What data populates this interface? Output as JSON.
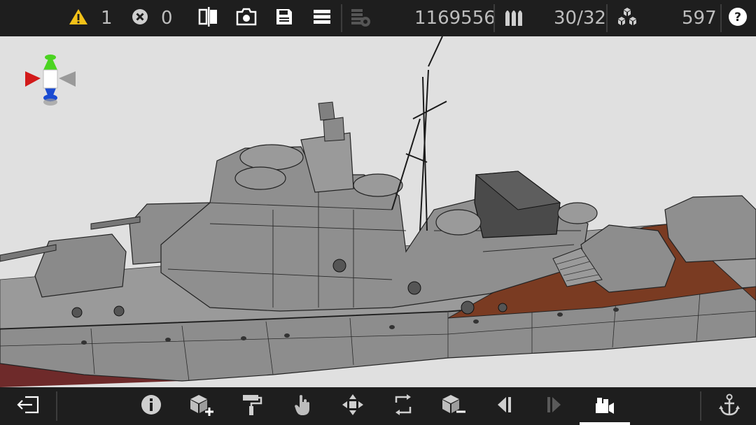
{
  "topbar": {
    "warnings_count": "1",
    "errors_count": "0",
    "polygon_count": "1169556",
    "ammo_count": "30/32",
    "parts_count": "597",
    "icons": {
      "warning": "warning-triangle-icon",
      "error": "error-circle-icon",
      "compare": "compare-split-icon",
      "camera": "camera-icon",
      "save": "save-disk-icon",
      "menu": "menu-icon",
      "polygons": "polygon-stack-icon",
      "ammo": "ammo-icon",
      "parts": "parts-cubes-icon",
      "help": "help-icon"
    }
  },
  "colors": {
    "bar_bg": "#1e1e1e",
    "viewport_bg": "#e0e0e0",
    "warning": "#f2c118",
    "hull_gray": "#8a8a8a",
    "deck_wood": "#7a3b22",
    "hull_red": "#6e2a2a",
    "gizmo_x": "#d21a1a",
    "gizmo_y": "#4bd421",
    "gizmo_z": "#1a4bd2"
  },
  "bottombar": {
    "buttons": [
      {
        "name": "exit-button",
        "icon": "exit-icon"
      },
      {
        "name": "info-button",
        "icon": "info-icon"
      },
      {
        "name": "add-part-button",
        "icon": "add-cube-icon"
      },
      {
        "name": "paint-button",
        "icon": "paint-roller-icon"
      },
      {
        "name": "select-button",
        "icon": "hand-pointer-icon"
      },
      {
        "name": "move-button",
        "icon": "move-arrows-icon"
      },
      {
        "name": "rotate-button",
        "icon": "rotate-icon"
      },
      {
        "name": "remove-part-button",
        "icon": "remove-cube-icon"
      },
      {
        "name": "undo-button",
        "icon": "undo-icon"
      },
      {
        "name": "redo-button",
        "icon": "redo-icon"
      },
      {
        "name": "camera-mode-button",
        "icon": "camera-mode-icon"
      },
      {
        "name": "anchor-button",
        "icon": "anchor-icon"
      }
    ],
    "active": "camera-mode-button"
  }
}
